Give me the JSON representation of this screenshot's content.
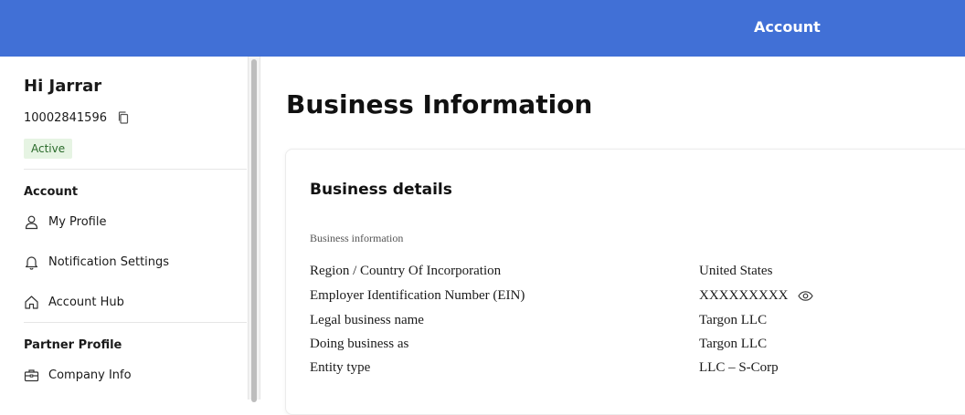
{
  "header": {
    "title": "Account"
  },
  "sidebar": {
    "greeting": "Hi Jarrar",
    "account_id": "10002841596",
    "status": "Active",
    "sections": [
      {
        "title": "Account",
        "items": [
          {
            "label": "My Profile",
            "icon": "user-icon"
          },
          {
            "label": "Notification Settings",
            "icon": "bell-icon"
          },
          {
            "label": "Account Hub",
            "icon": "home-icon"
          }
        ]
      },
      {
        "title": "Partner Profile",
        "items": [
          {
            "label": "Company Info",
            "icon": "briefcase-icon"
          }
        ]
      }
    ]
  },
  "main": {
    "page_title": "Business Information",
    "card": {
      "title": "Business details",
      "subtitle": "Business information",
      "rows": [
        {
          "label": "Region / Country Of Incorporation",
          "value": "United States"
        },
        {
          "label": "Employer Identification Number (EIN)",
          "value": "XXXXXXXXX"
        },
        {
          "label": "Legal business name",
          "value": "Targon LLC"
        },
        {
          "label": "Doing business as",
          "value": "Targon LLC"
        },
        {
          "label": "Entity type",
          "value": "LLC – S-Corp"
        }
      ]
    }
  },
  "colors": {
    "header_bg": "#4170d6",
    "status_bg": "#e6f4e3",
    "status_text": "#2a6a2a"
  }
}
